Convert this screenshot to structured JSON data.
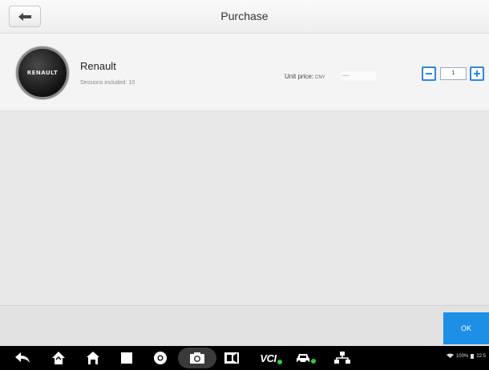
{
  "header": {
    "title": "Purchase",
    "back_icon": "arrow-left-icon"
  },
  "product": {
    "logo_text": "RENAULT",
    "name": "Renault",
    "sessions": "Sessions included: 10",
    "unit_price_label": "Unit price:",
    "currency": "CNY",
    "price_value": "•••••"
  },
  "quantity": {
    "minus_icon": "minus-icon",
    "value": "1",
    "plus_icon": "plus-icon"
  },
  "footer": {
    "ok_label": "OK"
  },
  "navbar": {
    "items": [
      "back-icon",
      "home-icon",
      "house-icon",
      "square-icon",
      "chrome-icon",
      "camera-icon",
      "video-icon",
      "vci-icon",
      "car-icon",
      "network-icon"
    ],
    "vci_label": "VCI",
    "status_text": "100%",
    "time_text": "22:5"
  },
  "colors": {
    "accent": "#1e8fe6",
    "stepper": "#2f86e4",
    "vci_dot": "#2ecc40"
  }
}
